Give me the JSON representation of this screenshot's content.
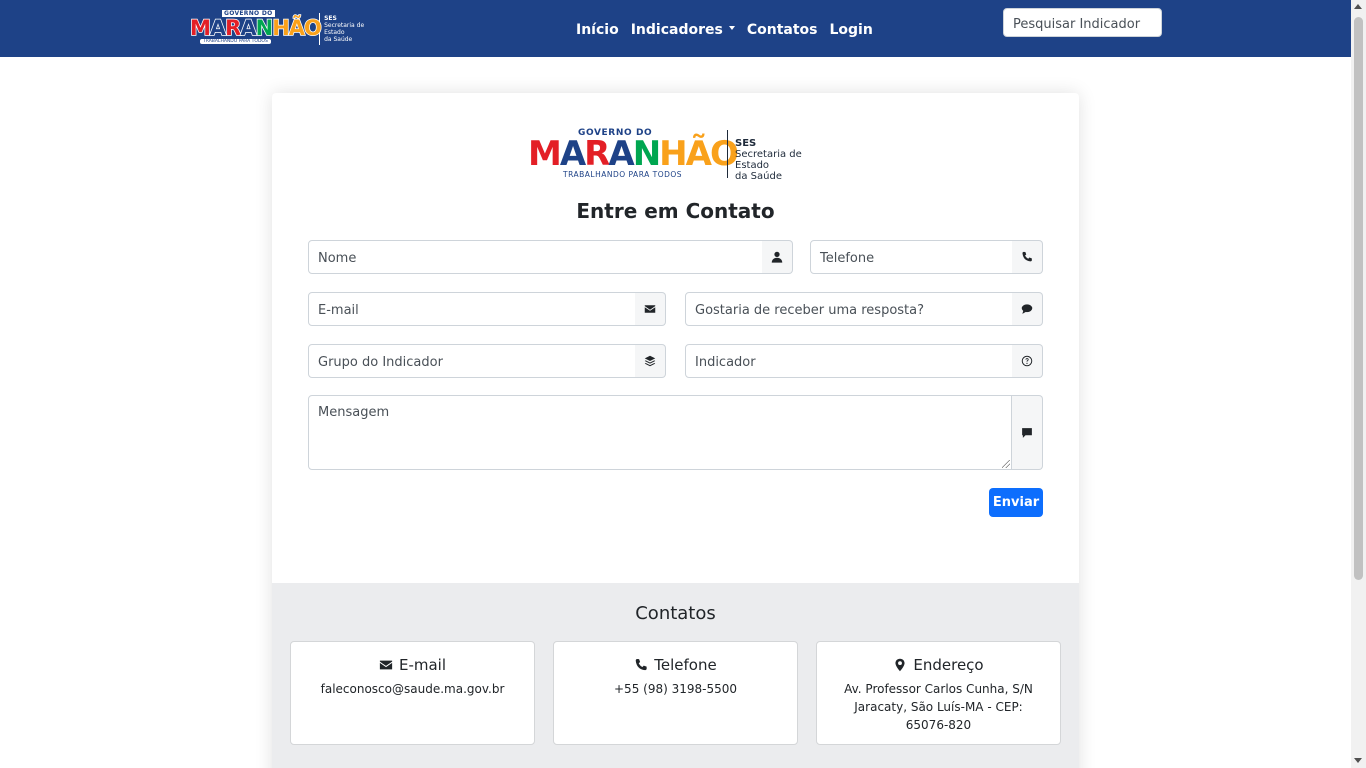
{
  "navbar": {
    "logo": {
      "governo": "GOVERNO DO",
      "word": [
        "M",
        "A",
        "R",
        "A",
        "N",
        "H",
        "Ã",
        "O"
      ],
      "tagline": "TRABALHANDO PARA TODOS",
      "ses": "SES",
      "ses_line1": "Secretaria de Estado",
      "ses_line2": "da Saúde"
    },
    "links": {
      "inicio": "Início",
      "indicadores": "Indicadores",
      "contatos": "Contatos",
      "login": "Login"
    },
    "search_placeholder": "Pesquisar Indicador"
  },
  "form": {
    "title": "Entre em Contato",
    "nome_placeholder": "Nome",
    "telefone_placeholder": "Telefone",
    "email_placeholder": "E-mail",
    "resposta_placeholder": "Gostaria de receber uma resposta?",
    "grupo_placeholder": "Grupo do Indicador",
    "indicador_placeholder": "Indicador",
    "mensagem_placeholder": "Mensagem",
    "submit_label": "Enviar"
  },
  "contacts": {
    "title": "Contatos",
    "email": {
      "label": "E-mail",
      "value": "faleconosco@saude.ma.gov.br"
    },
    "telefone": {
      "label": "Telefone",
      "value": "+55 (98) 3198-5500"
    },
    "endereco": {
      "label": "Endereço",
      "value": "Av. Professor Carlos Cunha, S/N Jaracaty, São Luís-MA - CEP: 65076-820"
    }
  },
  "icons": {
    "user": "user-icon",
    "phone": "phone-icon",
    "envelope": "envelope-icon",
    "comment": "comment-icon",
    "layers": "layers-icon",
    "question": "question-circle-icon",
    "message": "message-icon",
    "location": "map-marker-icon"
  },
  "colors": {
    "navbar": "#1e4287",
    "primary_button": "#0d6efd",
    "contacts_bg": "#ebecee",
    "logo_letters": [
      "#e31f26",
      "#1e4287",
      "#e31f26",
      "#1e4287",
      "#00a650",
      "#f9a11b",
      "#f9a11b",
      "#f9a11b"
    ]
  }
}
